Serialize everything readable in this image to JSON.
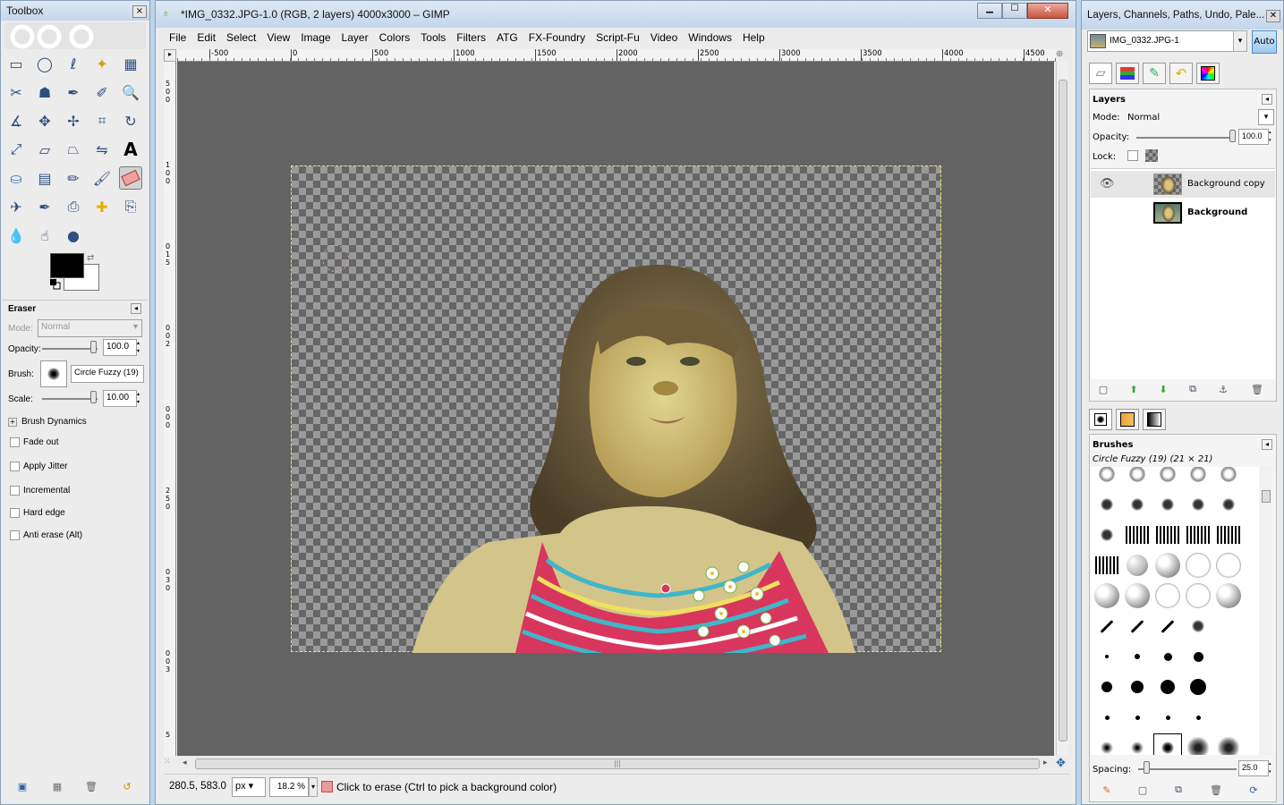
{
  "toolbox": {
    "title": "Toolbox",
    "tool_options_title": "Eraser",
    "mode_label": "Mode:",
    "mode_value": "Normal",
    "opacity_label": "Opacity:",
    "opacity_value": "100.0",
    "brush_label": "Brush:",
    "brush_value": "Circle Fuzzy (19)",
    "scale_label": "Scale:",
    "scale_value": "10.00",
    "brush_dynamics": "Brush Dynamics",
    "options": [
      "Fade out",
      "Apply Jitter",
      "Incremental",
      "Hard edge",
      "Anti erase  (Alt)"
    ],
    "tools": [
      "rect-select",
      "ellipse-select",
      "free-select",
      "fuzzy-select",
      "by-color-select",
      "scissors-select",
      "foreground-select",
      "paths",
      "color-picker",
      "zoom",
      "measure",
      "move",
      "align",
      "crop",
      "rotate",
      "scale",
      "shear",
      "perspective",
      "flip",
      "text",
      "bucket-fill",
      "blend",
      "pencil",
      "paintbrush",
      "eraser",
      "airbrush",
      "ink",
      "clone",
      "heal",
      "perspective-clone",
      "blur",
      "smudge",
      "dodge-burn"
    ]
  },
  "image_window": {
    "title": "*IMG_0332.JPG-1.0 (RGB, 2 layers) 4000x3000 – GIMP",
    "menu": [
      "File",
      "Edit",
      "Select",
      "View",
      "Image",
      "Layer",
      "Colors",
      "Tools",
      "Filters",
      "ATG",
      "FX-Foundry",
      "Script-Fu",
      "Video",
      "Windows",
      "Help"
    ],
    "ruler_h": [
      "-500",
      "0",
      "500",
      "1000",
      "1500",
      "2000",
      "2500",
      "3000",
      "3500",
      "4000",
      "4500"
    ],
    "ruler_v": [
      "5",
      "0",
      "0",
      "1",
      "0",
      "0",
      "0",
      "1",
      "5",
      "0",
      "0",
      "2",
      "0",
      "0",
      "0",
      "2",
      "5",
      "0",
      "0",
      "3",
      "0",
      "0",
      "0",
      "3",
      "5"
    ],
    "coords": "280.5, 583.0",
    "unit": "px",
    "zoom": "18.2 %",
    "status": "Click to erase (Ctrl to pick a background color)"
  },
  "dock": {
    "title": "Layers, Channels, Paths, Undo, Pale...",
    "image_select": "IMG_0332.JPG-1",
    "auto_label": "Auto",
    "layers_title": "Layers",
    "mode_label": "Mode:",
    "mode_value": "Normal",
    "opacity_label": "Opacity:",
    "opacity_value": "100.0",
    "lock_label": "Lock:",
    "layers": [
      {
        "name": "Background copy",
        "visible": true
      },
      {
        "name": "Background",
        "visible": false
      }
    ],
    "brushes_title": "Brushes",
    "brush_current": "Circle Fuzzy (19) (21 × 21)",
    "spacing_label": "Spacing:",
    "spacing_value": "25.0"
  },
  "colors": {
    "canvas_bg": "#636363",
    "accent_eraser": "#e85a5a",
    "highlight": "#3d7bd6"
  }
}
